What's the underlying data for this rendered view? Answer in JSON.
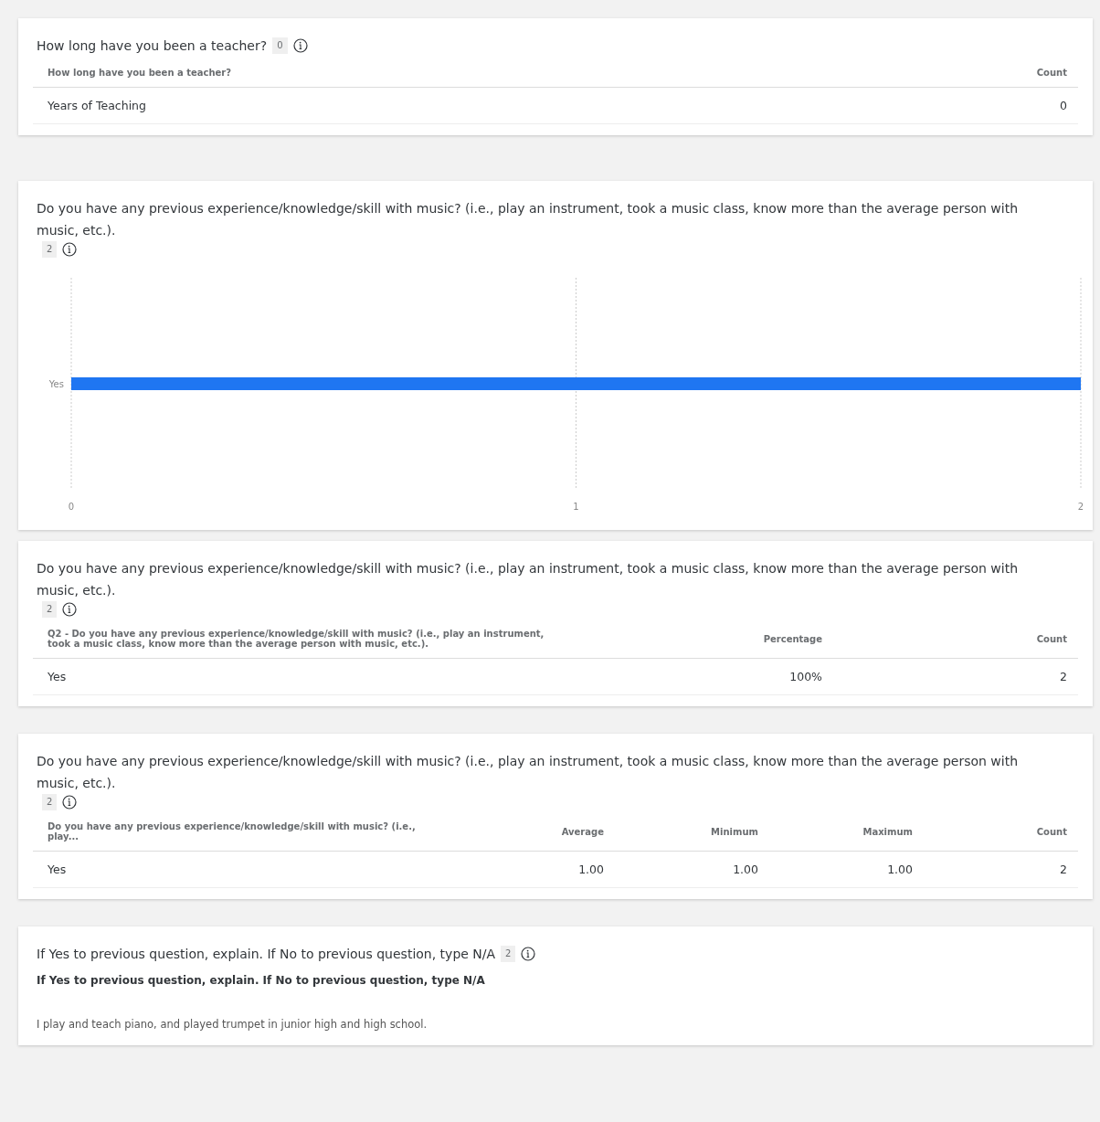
{
  "cards": [
    {
      "kind": "table",
      "title": "How long have you been a teacher?",
      "count": "0",
      "columns": [
        "How long have you been a teacher?",
        "Count"
      ],
      "rows": [
        [
          "Years of Teaching",
          "0"
        ]
      ]
    },
    {
      "kind": "chart",
      "title": "Do you have any previous experience/knowledge/skill with music? (i.e., play an instrument, took a music class, know more than the average person with music, etc.).",
      "count": "2",
      "chart_data": {
        "type": "bar",
        "orientation": "horizontal",
        "categories": [
          "Yes"
        ],
        "values": [
          2
        ],
        "xlim": [
          0,
          2
        ],
        "xticks": [
          0,
          1,
          2
        ]
      }
    },
    {
      "kind": "table",
      "title": "Do you have any previous experience/knowledge/skill with music? (i.e., play an instrument, took a music class, know more than the average person with music, etc.).",
      "count": "2",
      "columns": [
        "Q2 - Do you have any previous experience/knowledge/skill with music? (i.e., play an instrument, took a music class, know more than the average person with music, etc.).",
        "Percentage",
        "Count"
      ],
      "rows": [
        [
          "Yes",
          "100%",
          "2"
        ]
      ]
    },
    {
      "kind": "table",
      "title": "Do you have any previous experience/knowledge/skill with music? (i.e., play an instrument, took a music class, know more than the average person with music, etc.).",
      "count": "2",
      "columns": [
        "Do you have any previous experience/knowledge/skill with music? (i.e., play...",
        "Average",
        "Minimum",
        "Maximum",
        "Count"
      ],
      "rows": [
        [
          "Yes",
          "1.00",
          "1.00",
          "1.00",
          "2"
        ]
      ]
    },
    {
      "kind": "text",
      "title": "If Yes to previous question, explain. If No to previous question, type N/A",
      "count": "2",
      "heading": "If Yes to previous question, explain. If No to previous question, type N/A",
      "responses": [
        "I play and teach piano, and played trumpet in junior high and high school."
      ]
    }
  ]
}
